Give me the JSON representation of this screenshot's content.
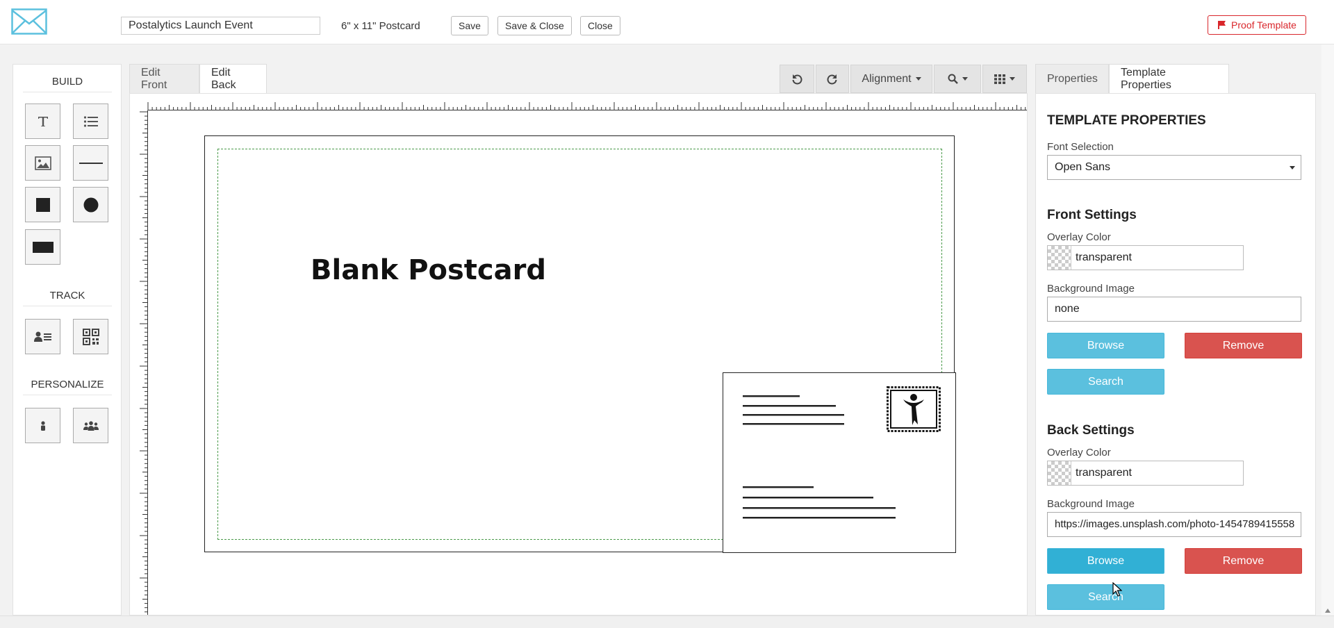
{
  "header": {
    "template_name": "Postalytics Launch Event",
    "size_label": "6\" x 11\" Postcard",
    "save_label": "Save",
    "save_close_label": "Save & Close",
    "close_label": "Close",
    "proof_label": "Proof Template",
    "proof_color": "#d9262b",
    "logo_icon": "envelope-icon",
    "logo_color": "#5bc0de"
  },
  "left_panel": {
    "build_title": "BUILD",
    "track_title": "TRACK",
    "personalize_title": "PERSONALIZE",
    "build_tools": [
      "text-tool",
      "list-tool",
      "image-tool",
      "line-tool",
      "square-tool",
      "circle-tool",
      "rectangle-tool"
    ],
    "track_tools": [
      "contact-card-tool",
      "qr-code-tool"
    ],
    "personalize_tools": [
      "single-person-tool",
      "group-tool"
    ]
  },
  "editor": {
    "tabs": [
      {
        "label": "Edit Front",
        "active": false
      },
      {
        "label": "Edit Back",
        "active": true
      }
    ],
    "toolbar": {
      "undo_icon": "undo-icon",
      "redo_icon": "redo-icon",
      "alignment_label": "Alignment",
      "zoom_icon": "search-icon",
      "grid_icon": "grid-icon"
    },
    "canvas": {
      "title": "Blank Postcard",
      "stamp_icon": "stamp-icon"
    }
  },
  "properties": {
    "tabs": [
      {
        "label": "Properties",
        "active": false
      },
      {
        "label": "Template Properties",
        "active": true
      }
    ],
    "heading": "TEMPLATE PROPERTIES",
    "font_label": "Font Selection",
    "font_value": "Open Sans",
    "front": {
      "title": "Front Settings",
      "overlay_label": "Overlay Color",
      "overlay_value": "transparent",
      "bg_label": "Background Image",
      "bg_value": "none",
      "browse_label": "Browse",
      "remove_label": "Remove",
      "search_label": "Search"
    },
    "back": {
      "title": "Back Settings",
      "overlay_label": "Overlay Color",
      "overlay_value": "transparent",
      "bg_label": "Background Image",
      "bg_value": "https://images.unsplash.com/photo-1454789415558",
      "browse_label": "Browse",
      "remove_label": "Remove",
      "search_label": "Search"
    },
    "accent_blue": "#5bc0de",
    "accent_red": "#d9534f"
  }
}
